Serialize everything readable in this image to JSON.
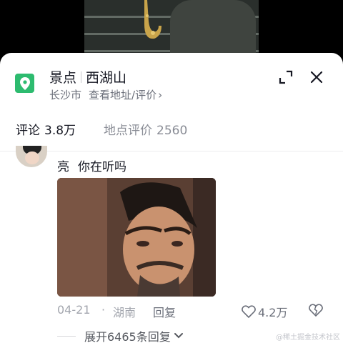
{
  "video": {
    "icon": "video-still"
  },
  "poi": {
    "icon": "map-pin-icon",
    "category": "景点",
    "name": "西湖山",
    "city": "长沙市",
    "address_link": "查看地址/评价",
    "chevron": "›"
  },
  "tabs": [
    {
      "label": "评论",
      "count": "3.8万",
      "active": true
    },
    {
      "label": "地点评价",
      "count": "2560",
      "active": false
    }
  ],
  "comment": {
    "author": "亮",
    "text": "你在听吗",
    "date": "04-21",
    "separator": "·",
    "location": "湖南",
    "reply_label": "回复",
    "likes": "4.2万",
    "expand_label": "展开6465条回复"
  },
  "watermark": "@稀土掘金技术社区",
  "colors": {
    "accent": "#2dbb6f",
    "text": "#161823",
    "muted": "#a3a6ae"
  }
}
